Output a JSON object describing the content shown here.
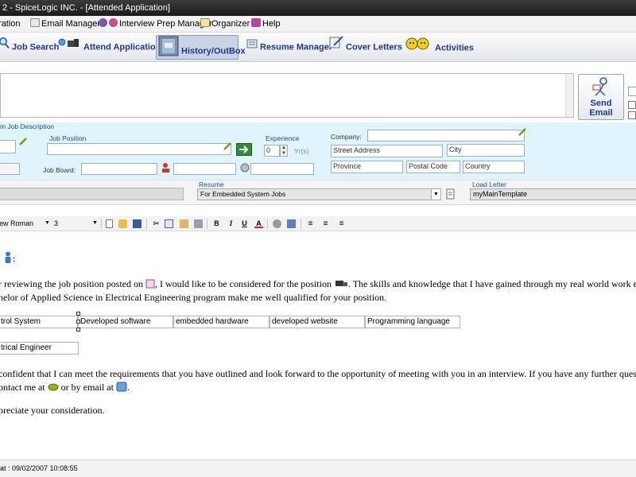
{
  "window": {
    "title": "2 - SpiceLogic INC. - [Attended Application]"
  },
  "menu": {
    "items": [
      "ration",
      "Email Manager",
      "Interview Prep Manager",
      "Organizer",
      "Help"
    ]
  },
  "nav": {
    "items": [
      "Job Search",
      "Attend Application",
      "History/OutBox",
      "Resume Manager",
      "Cover Letters",
      "Activities"
    ]
  },
  "send": {
    "label_line1": "Send",
    "label_line2": "Email"
  },
  "job": {
    "section_label": "m Job Description",
    "position_label": "Job Position",
    "position_value": "",
    "experience_label": "Experience",
    "experience_value": "0",
    "years_label": "Yr(s)",
    "job_board_label": "Job Board:",
    "company_label": "Company:",
    "company_value": "",
    "street_placeholder": "Street Address",
    "city_placeholder": "City",
    "province_placeholder": "Province",
    "postal_placeholder": "Postal Code",
    "country_placeholder": "Country"
  },
  "resume": {
    "label": "Resume",
    "selected": "For Embedded System Jobs",
    "load_letter_label": "Load Letter",
    "letter_value": "myMainTemplate"
  },
  "format": {
    "font_name": "ew Roman",
    "font_size": "3"
  },
  "letter": {
    "salutation_suffix": ":",
    "para1_start": "r reviewing the job position posted on",
    "para1_mid": ", I would like to be considered for the position",
    "para1_end": ". The skills and knowledge that I have gained through my real world work experi",
    "para1_line2": "helor of Applied Science in Electrical Engineering program make me well qualified for your position.",
    "skills": [
      "trol System",
      "Developed software",
      "embedded hardware",
      "developed website",
      "Programming language"
    ],
    "degree": "trical Engineer",
    "para2_line1": " confident that I can meet the requirements that you have outlined and look forward to the opportunity of meeting with you in an interview. If you have any further questions, p",
    "para2_line2_a": "ontact me at",
    "para2_line2_b": "or by email at",
    "para2_line2_c": ".",
    "closing": "preciate your consideration."
  },
  "status": {
    "text": "at : 09/02/2007 10:08:55"
  },
  "colors": {
    "accent": "#22398a",
    "panel_bg": "#dff5fb",
    "title_bg": "#1c1c1c"
  }
}
